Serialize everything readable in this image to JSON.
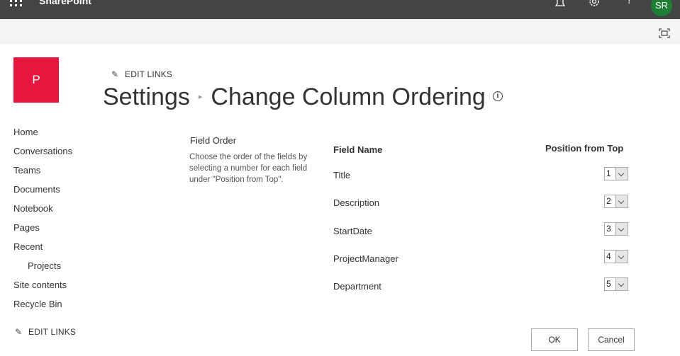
{
  "suite_bar": {
    "brand": "SharePoint",
    "icons": [
      "waffle-icon",
      "bell-icon",
      "gear-icon",
      "help-icon"
    ],
    "help_glyph": "?",
    "avatar_initials": "SR",
    "avatar_color": "#1e7e34"
  },
  "site": {
    "logo_letter": "P",
    "logo_color": "#e8163d"
  },
  "edit_links_label": "EDIT LINKS",
  "title": {
    "parent": "Settings",
    "current": "Change Column Ordering",
    "info_glyph": "i"
  },
  "quick_launch": {
    "items": [
      {
        "label": "Home"
      },
      {
        "label": "Conversations"
      },
      {
        "label": "Teams"
      },
      {
        "label": "Documents"
      },
      {
        "label": "Notebook"
      },
      {
        "label": "Pages"
      },
      {
        "label": "Recent"
      },
      {
        "label": "Projects"
      },
      {
        "label": "Site contents"
      },
      {
        "label": "Recycle Bin"
      }
    ]
  },
  "field_order": {
    "title": "Field Order",
    "description": "Choose the order of the fields by selecting a number for each field under \"Position from Top\".",
    "column_headers": {
      "field_name": "Field Name",
      "position": "Position from Top"
    },
    "rows": [
      {
        "field": "Title",
        "position": "1"
      },
      {
        "field": "Description",
        "position": "2"
      },
      {
        "field": "StartDate",
        "position": "3"
      },
      {
        "field": "ProjectManager",
        "position": "4"
      },
      {
        "field": "Department",
        "position": "5"
      }
    ]
  },
  "buttons": {
    "ok": "OK",
    "cancel": "Cancel"
  }
}
